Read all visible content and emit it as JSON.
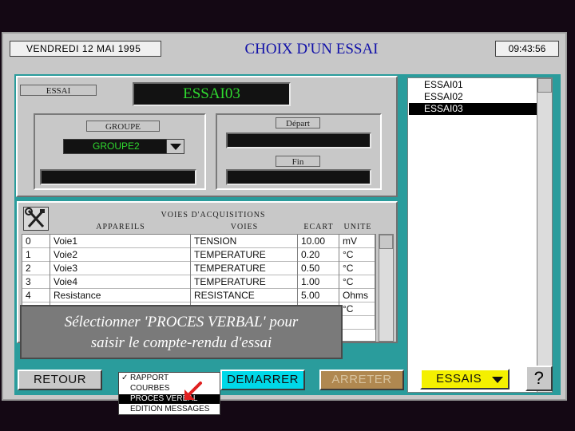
{
  "header": {
    "date": "VENDREDI 12 MAI 1995",
    "title": "CHOIX D'UN ESSAI",
    "time": "09:43:56"
  },
  "essai": {
    "label": "ESSAI",
    "value": "ESSAI03"
  },
  "groupe": {
    "label": "GROUPE",
    "selected": "GROUPE2"
  },
  "dates": {
    "depart_label": "Départ",
    "fin_label": "Fin"
  },
  "essai_list": {
    "items": [
      "ESSAI01",
      "ESSAI02",
      "ESSAI03"
    ],
    "selected": "ESSAI03"
  },
  "table": {
    "title": "VOIES D'ACQUISITIONS",
    "headers": [
      "APPAREILS",
      "VOIES",
      "ECART",
      "UNITE"
    ],
    "rows": [
      [
        "0",
        "Voie1",
        "TENSION",
        "10.00",
        "mV"
      ],
      [
        "1",
        "Voie2",
        "TEMPERATURE",
        "0.20",
        "°C"
      ],
      [
        "2",
        "Voie3",
        "TEMPERATURE",
        "0.50",
        "°C"
      ],
      [
        "3",
        "Voie4",
        "TEMPERATURE",
        "1.00",
        "°C"
      ],
      [
        "4",
        "Resistance",
        "RESISTANCE",
        "5.00",
        "Ohms"
      ],
      [
        "",
        "",
        "",
        "",
        "°C"
      ],
      [
        "",
        "",
        "",
        "",
        ""
      ]
    ]
  },
  "tooltip": {
    "line1": "Sélectionner 'PROCES VERBAL' pour",
    "line2": "saisir le compte-rendu d'essai"
  },
  "buttons": {
    "retour": "RETOUR",
    "demarrer": "DEMARRER",
    "arreter": "ARRETER",
    "essais": "ESSAIS",
    "help": "?"
  },
  "rapport_menu": {
    "items": [
      "RAPPORT",
      "COURBES",
      "PROCES VERBAL",
      "EDITION MESSAGES"
    ],
    "checked": "RAPPORT",
    "highlighted": "PROCES VERBAL"
  },
  "colors": {
    "teal": "#2a9c9c",
    "green_text": "#2fd92f",
    "title_blue": "#1010a8",
    "demarrer_cyan": "#00d8e8",
    "essais_yellow": "#f4f000",
    "arreter_brown": "#b08850",
    "cursor_red": "#e02020"
  },
  "icons": {
    "tool": "wrench-screwdriver-icon",
    "dropdown": "triangle-down-icon",
    "cursor": "red-arrow-cursor-icon"
  }
}
